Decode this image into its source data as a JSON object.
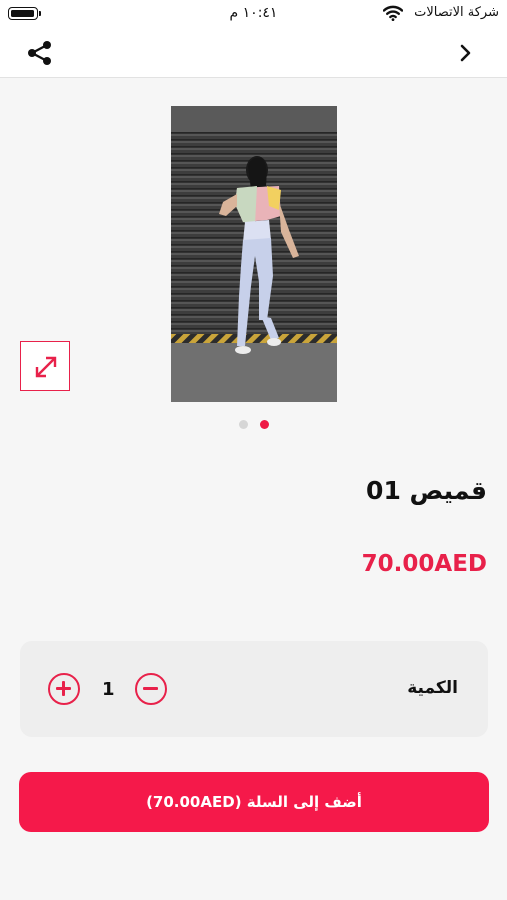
{
  "status_bar": {
    "time": "١٠:٤١ م",
    "carrier": "شركة الاتصالات",
    "icons": [
      "battery-icon",
      "wifi-icon"
    ]
  },
  "nav": {
    "icons": [
      "share-icon",
      "chevron-right-icon"
    ]
  },
  "gallery": {
    "image_subject": "model-photo",
    "page_count": 2,
    "active_index": 1,
    "expand_icon": "expand-icon"
  },
  "product": {
    "name": "قميص 01",
    "price": "70.00AED"
  },
  "quantity": {
    "label": "الكمية",
    "value": "1",
    "icons": [
      "plus-circle-icon",
      "minus-circle-icon"
    ]
  },
  "cart": {
    "button_label": "أضف إلى السلة (70.00AED)"
  },
  "colors": {
    "accent": "#f5194a",
    "price": "#e8214a",
    "background": "#f6f6f6"
  }
}
